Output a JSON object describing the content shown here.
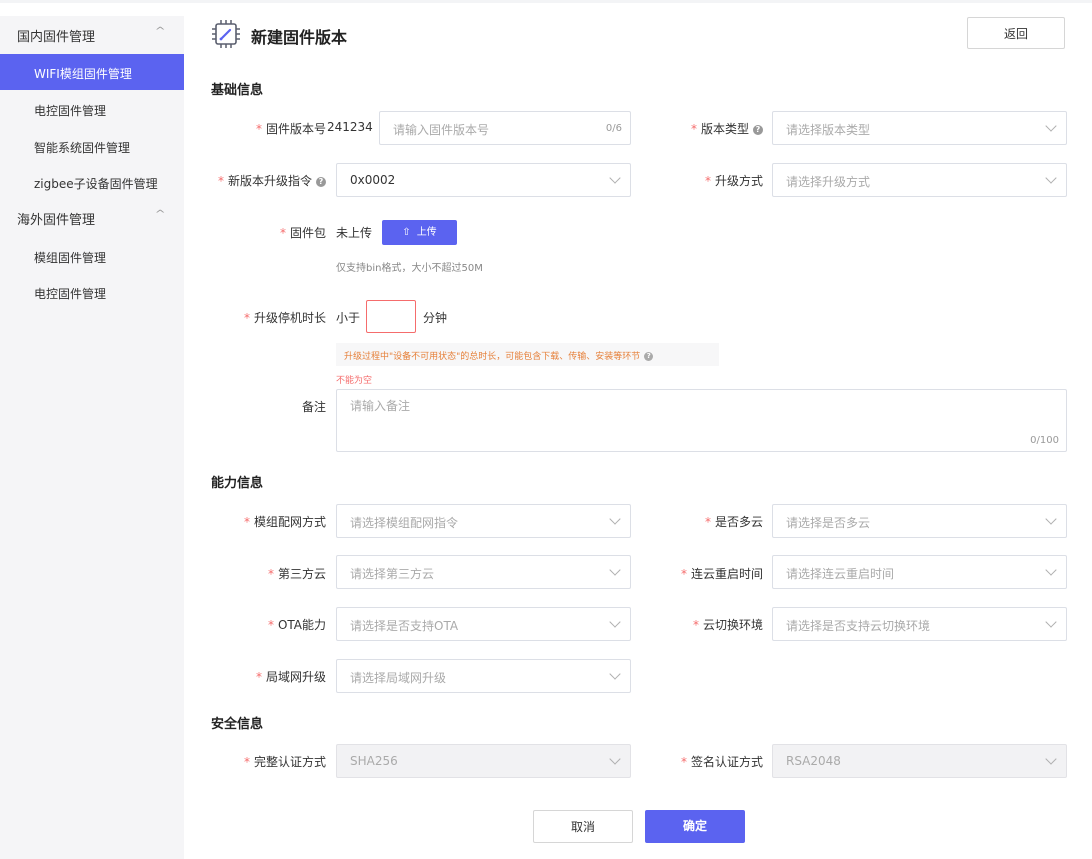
{
  "sidebar": {
    "groups": [
      {
        "title": "国内固件管理",
        "items": [
          "WIFI模组固件管理",
          "电控固件管理",
          "智能系统固件管理",
          "zigbee子设备固件管理"
        ]
      },
      {
        "title": "海外固件管理",
        "items": [
          "模组固件管理",
          "电控固件管理"
        ]
      }
    ],
    "collapse_glyph": "^"
  },
  "header": {
    "title": "新建固件版本",
    "back_label": "返回",
    "icon": "chip-edit-icon"
  },
  "basic": {
    "title": "基础信息",
    "fw_version_label": "固件版本号",
    "fw_version_prefix": "241234",
    "fw_version_placeholder": "请输入固件版本号",
    "fw_version_count": "0/6",
    "version_type_label": "版本类型",
    "version_type_placeholder": "请选择版本类型",
    "upgrade_cmd_label": "新版本升级指令",
    "upgrade_cmd_value": "0x0002",
    "upgrade_mode_label": "升级方式",
    "upgrade_mode_placeholder": "请选择升级方式",
    "package_label": "固件包",
    "package_status": "未上传",
    "upload_label": "上传",
    "package_hint": "仅支持bin格式，大小不超过50M",
    "downtime_label": "升级停机时长",
    "downtime_prefix": "小于",
    "downtime_unit": "分钟",
    "downtime_tip": "升级过程中\"设备不可用状态\"的总时长，可能包含下载、传输、安装等环节",
    "downtime_error": "不能为空",
    "remark_label": "备注",
    "remark_placeholder": "请输入备注",
    "remark_count": "0/100"
  },
  "ability": {
    "title": "能力信息",
    "network_label": "模组配网方式",
    "network_placeholder": "请选择模组配网指令",
    "multicloud_label": "是否多云",
    "multicloud_placeholder": "请选择是否多云",
    "thirdcloud_label": "第三方云",
    "thirdcloud_placeholder": "请选择第三方云",
    "restart_label": "连云重启时间",
    "restart_placeholder": "请选择连云重启时间",
    "ota_label": "OTA能力",
    "ota_placeholder": "请选择是否支持OTA",
    "cloudswitch_label": "云切换环境",
    "cloudswitch_placeholder": "请选择是否支持云切换环境",
    "lan_label": "局域网升级",
    "lan_placeholder": "请选择局域网升级"
  },
  "security": {
    "title": "安全信息",
    "integrity_label": "完整认证方式",
    "integrity_value": "SHA256",
    "signature_label": "签名认证方式",
    "signature_value": "RSA2048"
  },
  "footer": {
    "cancel_label": "取消",
    "ok_label": "确定"
  },
  "colors": {
    "accent": "#5b63f0",
    "required": "#f56c6c",
    "warning": "#e6803a",
    "sidebar_bg": "#f5f5f7"
  }
}
